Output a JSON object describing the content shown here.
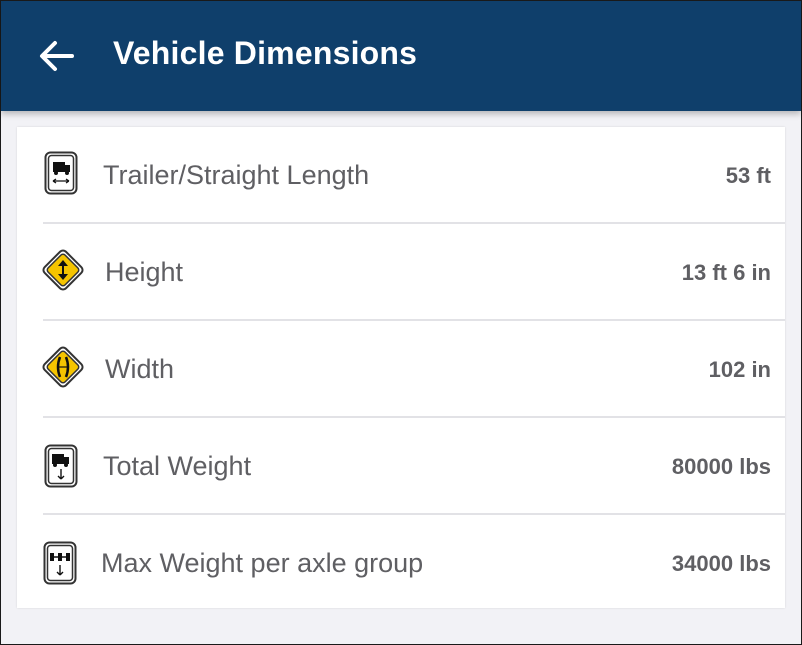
{
  "header": {
    "title": "Vehicle Dimensions",
    "back_icon": "arrow-back-icon",
    "background_color": "#0f3f6b"
  },
  "dimensions": [
    {
      "label": "Trailer/Straight Length",
      "value": "53 ft",
      "icon": "truck-length-sign-icon"
    },
    {
      "label": "Height",
      "value": "13 ft 6 in",
      "icon": "height-warning-sign-icon"
    },
    {
      "label": "Width",
      "value": "102 in",
      "icon": "width-warning-sign-icon"
    },
    {
      "label": "Total Weight",
      "value": "80000 lbs",
      "icon": "truck-weight-sign-icon"
    },
    {
      "label": "Max Weight per axle group",
      "value": "34000 lbs",
      "icon": "axle-weight-sign-icon"
    }
  ],
  "colors": {
    "accent": "#0f3f6b",
    "warning_yellow": "#f5c400",
    "text": "#5f5f63"
  }
}
